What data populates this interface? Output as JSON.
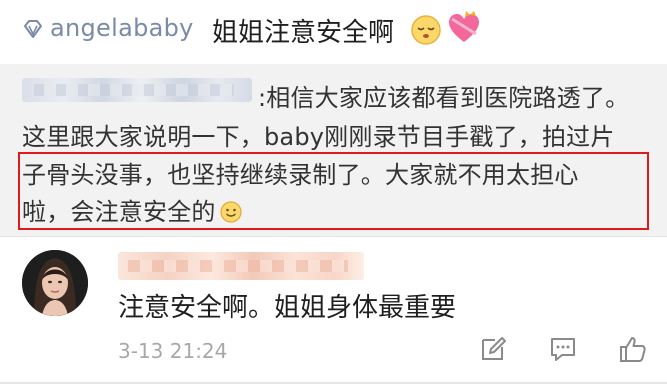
{
  "post": {
    "author": "angelababy",
    "text": "姐姐注意安全啊",
    "icons": [
      "vip-diamond-icon",
      "sleepy-face-emoji-icon",
      "heart-with-ribbon-emoji-icon"
    ]
  },
  "quoted_comment": {
    "author_name": "",
    "line1": ":相信大家应该都看到医院路透了。",
    "line2": "这里跟大家说明一下，baby刚刚录节目手戳了，拍过片",
    "line3": "子骨头没事，也坚持继续录制了。大家就不用太担心",
    "line4": "啦，会注意安全的",
    "emoji": "smile-face-emoji-icon",
    "highlight_color": "#e01a1a"
  },
  "comment": {
    "author_name": "",
    "text": "注意安全啊。姐姐身体最重要",
    "timestamp": "3-13 21:24",
    "actions": [
      "edit-icon",
      "comment-icon",
      "like-icon"
    ]
  },
  "colors": {
    "author": "#7b8aa6",
    "timestamp": "#a8a8a8",
    "quote_bg": "#f2f2f2"
  }
}
